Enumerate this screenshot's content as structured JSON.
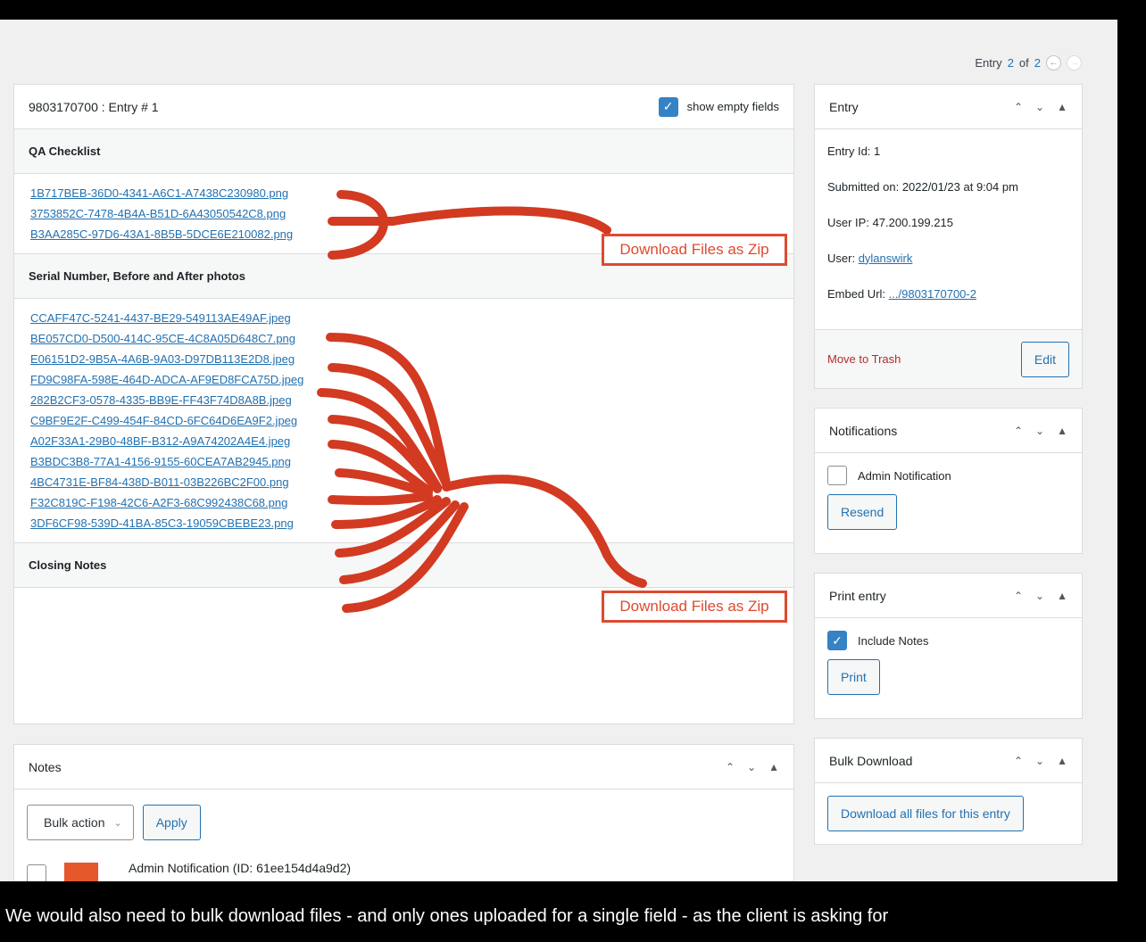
{
  "pager": {
    "label": "Entry",
    "current": "2",
    "of": "of",
    "total": "2",
    "prev_icon": "←",
    "next_icon": "→"
  },
  "main": {
    "title": "9803170700 : Entry # 1",
    "show_empty_label": "show empty fields",
    "show_empty_checked": true,
    "sections": [
      {
        "label": "QA Checklist",
        "files": [
          "1B717BEB-36D0-4341-A6C1-A7438C230980.png",
          "3753852C-7478-4B4A-B51D-6A43050542C8.png",
          "B3AA285C-97D6-43A1-8B5B-5DCE6E210082.png"
        ]
      },
      {
        "label": "Serial Number, Before and After photos",
        "files": [
          "CCAFF47C-5241-4437-BE29-549113AE49AF.jpeg",
          "BE057CD0-D500-414C-95CE-4C8A05D648C7.png",
          "E06151D2-9B5A-4A6B-9A03-D97DB113E2D8.jpeg",
          "FD9C98FA-598E-464D-ADCA-AF9ED8FCA75D.jpeg",
          "282B2CF3-0578-4335-BB9E-FF43F74D8A8B.jpeg",
          "C9BF9E2F-C499-454F-84CD-6FC64D6EA9F2.jpeg",
          "A02F33A1-29B0-48BF-B312-A9A74202A4E4.jpeg",
          "B3BDC3B8-77A1-4156-9155-60CEA7AB2945.png",
          "4BC4731E-BF84-438D-B011-03B226BC2F00.png",
          "F32C819C-F198-42C6-A2F3-68C992438C68.png",
          "3DF6CF98-539D-41BA-85C3-19059CBEBE23.png"
        ]
      },
      {
        "label": "Closing Notes",
        "files": []
      }
    ],
    "download_zip_label": "Download Files as Zip"
  },
  "notes": {
    "title": "Notes",
    "bulk_action_label": "Bulk action",
    "apply_label": "Apply",
    "first_note": "Admin Notification (ID: 61ee154d4a9d2)"
  },
  "entry_box": {
    "title": "Entry",
    "entry_id": "Entry Id: 1",
    "submitted": "Submitted on: 2022/01/23 at 9:04 pm",
    "user_ip": "User IP: 47.200.199.215",
    "user_label": "User:",
    "user_link": "dylanswirk",
    "embed_label": "Embed Url:",
    "embed_link": ".../9803170700-2",
    "trash_label": "Move to Trash",
    "edit_label": "Edit"
  },
  "notifications_box": {
    "title": "Notifications",
    "admin_label": "Admin Notification",
    "admin_checked": false,
    "resend_label": "Resend"
  },
  "print_box": {
    "title": "Print entry",
    "include_notes_label": "Include Notes",
    "include_notes_checked": true,
    "print_label": "Print"
  },
  "bulk_box": {
    "title": "Bulk Download",
    "download_all_label": "Download all files for this entry"
  },
  "panel_controls": {
    "up": "⌃",
    "down": "⌄",
    "toggle": "▲"
  },
  "caption": "We would also need to bulk download files - and only ones uploaded for a single field - as the client is asking for",
  "colors": {
    "annotation": "#d23a22",
    "link": "#2271b1",
    "accent": "#3582c4",
    "trash": "#b32d2e"
  }
}
